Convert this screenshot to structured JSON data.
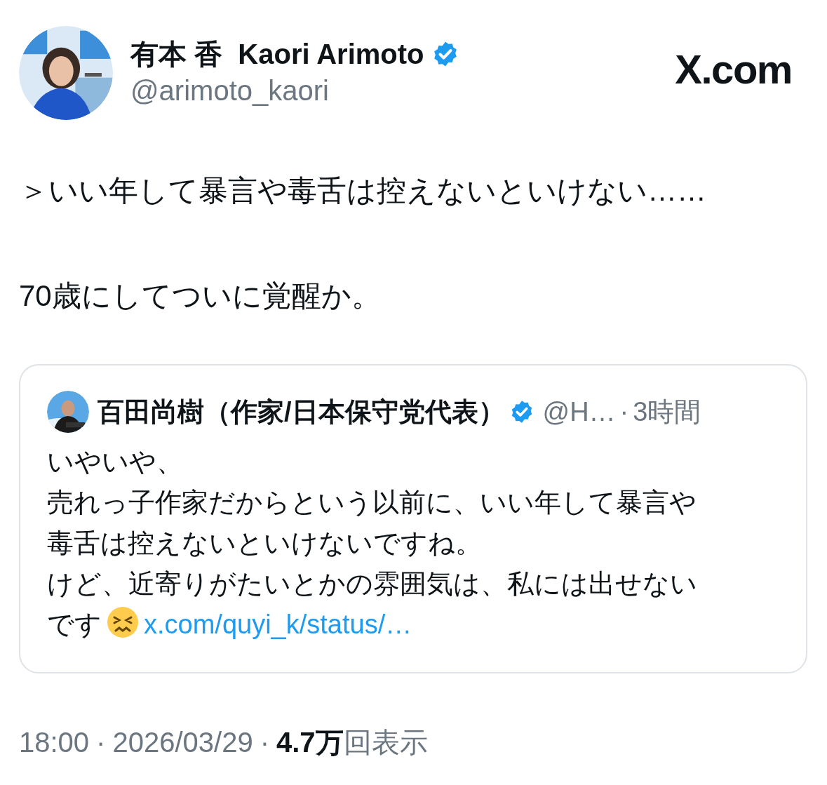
{
  "author": {
    "name": "有本 香  Kaori Arimoto",
    "verified": true,
    "handle": "@arimoto_kaori"
  },
  "brand": "X.com",
  "body": [
    "＞いい年して暴言や毒舌は控えないといけない……",
    "70歳にしてついに覚醒か。"
  ],
  "quote": {
    "name": "百田尚樹（作家/日本保守党代表）",
    "verified": true,
    "handle": "@H…",
    "separator": "·",
    "time": "3時間",
    "lines": [
      "いやいや、",
      "売れっ子作家だからという以前に、いい年して暴言や",
      "毒舌は控えないといけないですね。",
      "けど、近寄りがたいとかの雰囲気は、私には出せない",
      "です"
    ],
    "link": "x.com/quyi_k/status/…"
  },
  "meta": [
    {
      "kind": "time",
      "text": "18:00"
    },
    {
      "kind": "separator",
      "text": "·"
    },
    {
      "kind": "date",
      "text": "2026/03/29"
    },
    {
      "kind": "separator",
      "text": "·"
    },
    {
      "kind": "count",
      "text": "4.7万"
    },
    {
      "kind": "label",
      "text": "回表示"
    }
  ]
}
